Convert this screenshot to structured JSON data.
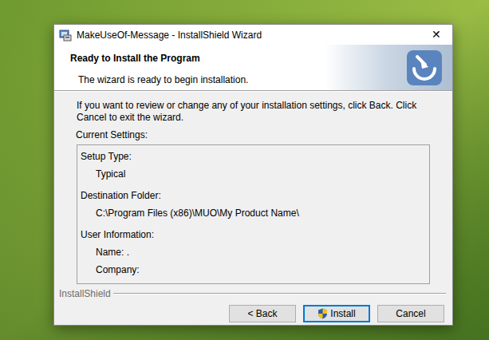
{
  "window": {
    "title": "MakeUseOf-Message - InstallShield Wizard",
    "close": "✕"
  },
  "header": {
    "title": "Ready to Install the Program",
    "subtitle": "The wizard is ready to begin installation."
  },
  "instructions": "If you want to review or change any of your installation settings, click Back. Click Cancel to exit the wizard.",
  "settings": {
    "label": "Current Settings:",
    "groups": [
      {
        "heading": "Setup Type:",
        "lines": [
          "Typical"
        ]
      },
      {
        "heading": "Destination Folder:",
        "lines": [
          "C:\\Program Files (x86)\\MUO\\My Product Name\\"
        ]
      },
      {
        "heading": "User Information:",
        "lines": [
          "Name: .",
          "Company:"
        ]
      }
    ]
  },
  "footer": {
    "brand": "InstallShield"
  },
  "buttons": [
    {
      "label": "< Back",
      "default": false,
      "shield": false
    },
    {
      "label": "Install",
      "default": true,
      "shield": true
    },
    {
      "label": "Cancel",
      "default": false,
      "shield": false
    }
  ]
}
